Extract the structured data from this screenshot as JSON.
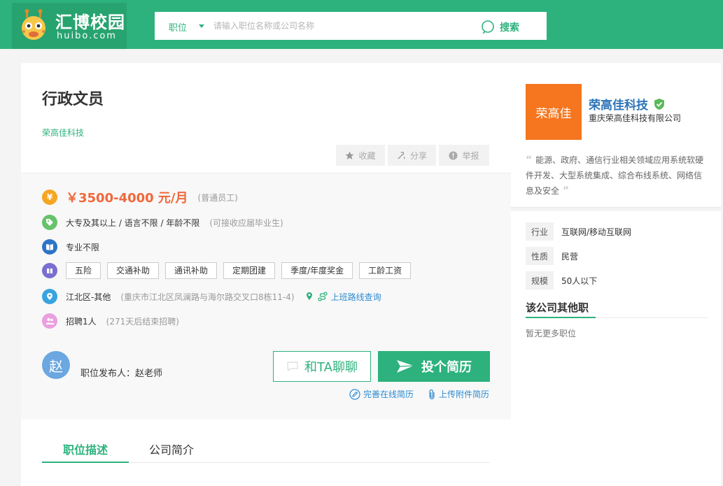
{
  "header": {
    "logo_title": "汇博校园",
    "logo_sub": "huibo.com",
    "search_type": "职位",
    "search_placeholder": "请输入职位名称或公司名称",
    "search_button": "搜索"
  },
  "job": {
    "title": "行政文员",
    "company": "荣高佳科技",
    "actions": {
      "favorite": "收藏",
      "share": "分享",
      "report": "举报"
    },
    "salary": "￥3500-4000 元/月",
    "level": "(普通员工)",
    "requirements": "大专及其以上 / 语言不限 / 年龄不限",
    "requirements_note": "(可接收应届毕业生)",
    "major": "专业不限",
    "benefits": [
      "五险",
      "交通补助",
      "通讯补助",
      "定期团建",
      "季度/年度奖金",
      "工龄工资"
    ],
    "location": "江北区-其他",
    "address": "(重庆市江北区凤澜路与海尔路交叉口8栋11-4)",
    "route_link": "上班路线查询",
    "headcount": "招聘1人",
    "deadline": "(271天后结束招聘)",
    "publisher_initial": "赵",
    "publisher": "职位发布人：赵老师",
    "chat_button": "和TA聊聊",
    "apply_button": "投个简历",
    "complete_resume": "完善在线简历",
    "upload_resume": "上传附件简历"
  },
  "tabs": {
    "description": "职位描述",
    "company_intro": "公司简介"
  },
  "sidebar": {
    "logo_text": "荣高佳",
    "company_name": "荣高佳科技",
    "company_full": "重庆荣高佳科技有限公司",
    "intro": "能源、政府、通信行业相关领域应用系统软硬件开发、大型系统集成、综合布线系统、网络信息及安全",
    "info": [
      {
        "label": "行业",
        "value": "互联网/移动互联网"
      },
      {
        "label": "性质",
        "value": "民营"
      },
      {
        "label": "规模",
        "value": "50人以下"
      }
    ],
    "other_jobs_title": "该公司其他职",
    "no_more_jobs": "暂无更多职位"
  },
  "colors": {
    "brand_green": "#2db27d",
    "salary_orange": "#f0683b",
    "link_blue": "#2d8bd1",
    "company_logo_orange": "#f5761f"
  }
}
